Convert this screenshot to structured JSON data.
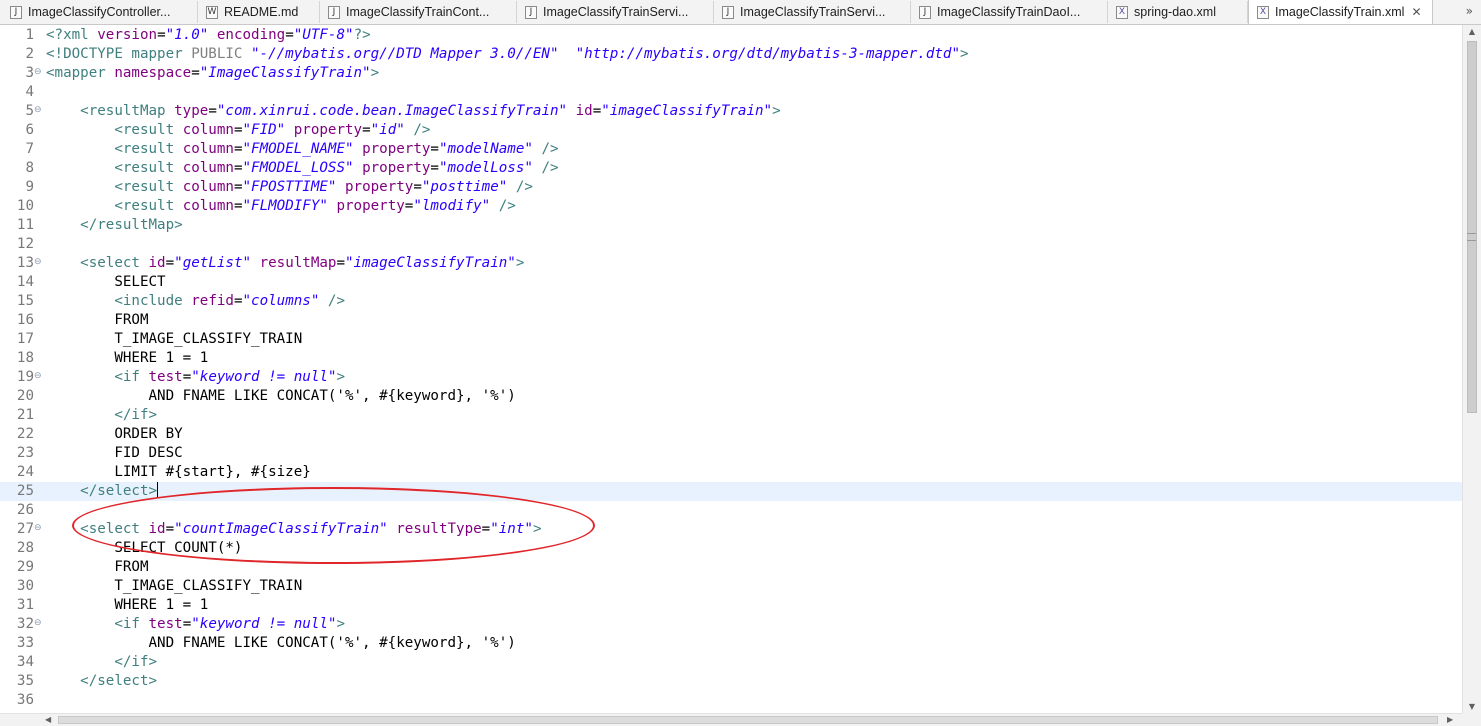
{
  "tabs": [
    {
      "label": "ImageClassifyController...",
      "icon": "java-file-icon",
      "glyph": "J",
      "active": false
    },
    {
      "label": "README.md",
      "icon": "markdown-file-icon",
      "glyph": "W",
      "active": false
    },
    {
      "label": "ImageClassifyTrainCont...",
      "icon": "java-file-icon",
      "glyph": "J",
      "active": false
    },
    {
      "label": "ImageClassifyTrainServi...",
      "icon": "java-file-icon",
      "glyph": "J",
      "active": false
    },
    {
      "label": "ImageClassifyTrainServi...",
      "icon": "java-file-icon",
      "glyph": "J",
      "active": false
    },
    {
      "label": "ImageClassifyTrainDaoI...",
      "icon": "java-file-icon",
      "glyph": "J",
      "active": false
    },
    {
      "label": "spring-dao.xml",
      "icon": "xml-file-icon",
      "glyph": "X",
      "active": false
    },
    {
      "label": "ImageClassifyTrain.xml",
      "icon": "xml-file-icon",
      "glyph": "X",
      "active": true,
      "close": "✕"
    }
  ],
  "tab_overflow": "»",
  "colors": {
    "tag": "#3f7f7f",
    "attribute": "#7f007f",
    "value": "#2a00ff",
    "annotation": "#e0262a",
    "current_line": "#e8f2fe"
  },
  "current_line": 25,
  "annotated_line": 27,
  "lines": [
    {
      "n": "1",
      "fold": "",
      "tokens": [
        [
          "t",
          "<?"
        ],
        [
          "t",
          "xml"
        ],
        [
          "p",
          " "
        ],
        [
          "a",
          "version"
        ],
        [
          "p",
          "="
        ],
        [
          "v",
          "\"1.0\""
        ],
        [
          "p",
          " "
        ],
        [
          "a",
          "encoding"
        ],
        [
          "p",
          "="
        ],
        [
          "v",
          "\"UTF-8\""
        ],
        [
          "t",
          "?>"
        ]
      ]
    },
    {
      "n": "2",
      "fold": "",
      "tokens": [
        [
          "t",
          "<!DOCTYPE mapper "
        ],
        [
          "d",
          "PUBLIC"
        ],
        [
          "p",
          " "
        ],
        [
          "v",
          "\"-//mybatis.org//DTD Mapper 3.0//EN\""
        ],
        [
          "p",
          "  "
        ],
        [
          "v",
          "\"http://mybatis.org/dtd/mybatis-3-mapper.dtd\""
        ],
        [
          "t",
          ">"
        ]
      ]
    },
    {
      "n": "3",
      "fold": "⊖",
      "tokens": [
        [
          "t",
          "<mapper"
        ],
        [
          "p",
          " "
        ],
        [
          "a",
          "namespace"
        ],
        [
          "p",
          "="
        ],
        [
          "v",
          "\"ImageClassifyTrain\""
        ],
        [
          "t",
          ">"
        ]
      ]
    },
    {
      "n": "4",
      "fold": "",
      "tokens": []
    },
    {
      "n": "5",
      "fold": "⊖",
      "tokens": [
        [
          "p",
          "    "
        ],
        [
          "t",
          "<resultMap"
        ],
        [
          "p",
          " "
        ],
        [
          "a",
          "type"
        ],
        [
          "p",
          "="
        ],
        [
          "v",
          "\"com.xinrui.code.bean.ImageClassifyTrain\""
        ],
        [
          "p",
          " "
        ],
        [
          "a",
          "id"
        ],
        [
          "p",
          "="
        ],
        [
          "v",
          "\"imageClassifyTrain\""
        ],
        [
          "t",
          ">"
        ]
      ]
    },
    {
      "n": "6",
      "fold": "",
      "tokens": [
        [
          "p",
          "        "
        ],
        [
          "t",
          "<result"
        ],
        [
          "p",
          " "
        ],
        [
          "a",
          "column"
        ],
        [
          "p",
          "="
        ],
        [
          "v",
          "\"FID\""
        ],
        [
          "p",
          " "
        ],
        [
          "a",
          "property"
        ],
        [
          "p",
          "="
        ],
        [
          "v",
          "\"id\""
        ],
        [
          "p",
          " "
        ],
        [
          "t",
          "/>"
        ]
      ]
    },
    {
      "n": "7",
      "fold": "",
      "tokens": [
        [
          "p",
          "        "
        ],
        [
          "t",
          "<result"
        ],
        [
          "p",
          " "
        ],
        [
          "a",
          "column"
        ],
        [
          "p",
          "="
        ],
        [
          "v",
          "\"FMODEL_NAME\""
        ],
        [
          "p",
          " "
        ],
        [
          "a",
          "property"
        ],
        [
          "p",
          "="
        ],
        [
          "v",
          "\"modelName\""
        ],
        [
          "p",
          " "
        ],
        [
          "t",
          "/>"
        ]
      ]
    },
    {
      "n": "8",
      "fold": "",
      "tokens": [
        [
          "p",
          "        "
        ],
        [
          "t",
          "<result"
        ],
        [
          "p",
          " "
        ],
        [
          "a",
          "column"
        ],
        [
          "p",
          "="
        ],
        [
          "v",
          "\"FMODEL_LOSS\""
        ],
        [
          "p",
          " "
        ],
        [
          "a",
          "property"
        ],
        [
          "p",
          "="
        ],
        [
          "v",
          "\"modelLoss\""
        ],
        [
          "p",
          " "
        ],
        [
          "t",
          "/>"
        ]
      ]
    },
    {
      "n": "9",
      "fold": "",
      "tokens": [
        [
          "p",
          "        "
        ],
        [
          "t",
          "<result"
        ],
        [
          "p",
          " "
        ],
        [
          "a",
          "column"
        ],
        [
          "p",
          "="
        ],
        [
          "v",
          "\"FPOSTTIME\""
        ],
        [
          "p",
          " "
        ],
        [
          "a",
          "property"
        ],
        [
          "p",
          "="
        ],
        [
          "v",
          "\"posttime\""
        ],
        [
          "p",
          " "
        ],
        [
          "t",
          "/>"
        ]
      ]
    },
    {
      "n": "10",
      "fold": "",
      "tokens": [
        [
          "p",
          "        "
        ],
        [
          "t",
          "<result"
        ],
        [
          "p",
          " "
        ],
        [
          "a",
          "column"
        ],
        [
          "p",
          "="
        ],
        [
          "v",
          "\"FLMODIFY\""
        ],
        [
          "p",
          " "
        ],
        [
          "a",
          "property"
        ],
        [
          "p",
          "="
        ],
        [
          "v",
          "\"lmodify\""
        ],
        [
          "p",
          " "
        ],
        [
          "t",
          "/>"
        ]
      ]
    },
    {
      "n": "11",
      "fold": "",
      "tokens": [
        [
          "p",
          "    "
        ],
        [
          "t",
          "</resultMap>"
        ]
      ]
    },
    {
      "n": "12",
      "fold": "",
      "tokens": []
    },
    {
      "n": "13",
      "fold": "⊖",
      "tokens": [
        [
          "p",
          "    "
        ],
        [
          "t",
          "<select"
        ],
        [
          "p",
          " "
        ],
        [
          "a",
          "id"
        ],
        [
          "p",
          "="
        ],
        [
          "v",
          "\"getList\""
        ],
        [
          "p",
          " "
        ],
        [
          "a",
          "resultMap"
        ],
        [
          "p",
          "="
        ],
        [
          "v",
          "\"imageClassifyTrain\""
        ],
        [
          "t",
          ">"
        ]
      ]
    },
    {
      "n": "14",
      "fold": "",
      "tokens": [
        [
          "p",
          "        SELECT"
        ]
      ]
    },
    {
      "n": "15",
      "fold": "",
      "tokens": [
        [
          "p",
          "        "
        ],
        [
          "t",
          "<include"
        ],
        [
          "p",
          " "
        ],
        [
          "a",
          "refid"
        ],
        [
          "p",
          "="
        ],
        [
          "v",
          "\"columns\""
        ],
        [
          "p",
          " "
        ],
        [
          "t",
          "/>"
        ]
      ]
    },
    {
      "n": "16",
      "fold": "",
      "tokens": [
        [
          "p",
          "        FROM"
        ]
      ]
    },
    {
      "n": "17",
      "fold": "",
      "tokens": [
        [
          "p",
          "        T_IMAGE_CLASSIFY_TRAIN"
        ]
      ]
    },
    {
      "n": "18",
      "fold": "",
      "tokens": [
        [
          "p",
          "        WHERE 1 = 1"
        ]
      ]
    },
    {
      "n": "19",
      "fold": "⊖",
      "tokens": [
        [
          "p",
          "        "
        ],
        [
          "t",
          "<if"
        ],
        [
          "p",
          " "
        ],
        [
          "a",
          "test"
        ],
        [
          "p",
          "="
        ],
        [
          "v",
          "\"keyword != null\""
        ],
        [
          "t",
          ">"
        ]
      ]
    },
    {
      "n": "20",
      "fold": "",
      "tokens": [
        [
          "p",
          "            AND FNAME LIKE CONCAT('%', #{keyword}, '%')"
        ]
      ]
    },
    {
      "n": "21",
      "fold": "",
      "tokens": [
        [
          "p",
          "        "
        ],
        [
          "t",
          "</if>"
        ]
      ]
    },
    {
      "n": "22",
      "fold": "",
      "tokens": [
        [
          "p",
          "        ORDER BY"
        ]
      ]
    },
    {
      "n": "23",
      "fold": "",
      "tokens": [
        [
          "p",
          "        FID DESC"
        ]
      ]
    },
    {
      "n": "24",
      "fold": "",
      "tokens": [
        [
          "p",
          "        LIMIT #{start}, #{size}"
        ]
      ]
    },
    {
      "n": "25",
      "fold": "",
      "tokens": [
        [
          "p",
          "    "
        ],
        [
          "t",
          "</select>"
        ]
      ],
      "caret": true
    },
    {
      "n": "26",
      "fold": "",
      "tokens": []
    },
    {
      "n": "27",
      "fold": "⊖",
      "tokens": [
        [
          "p",
          "    "
        ],
        [
          "t",
          "<select"
        ],
        [
          "p",
          " "
        ],
        [
          "a",
          "id"
        ],
        [
          "p",
          "="
        ],
        [
          "v",
          "\"countImageClassifyTrain\""
        ],
        [
          "p",
          " "
        ],
        [
          "a",
          "resultType"
        ],
        [
          "p",
          "="
        ],
        [
          "v",
          "\"int\""
        ],
        [
          "t",
          ">"
        ]
      ]
    },
    {
      "n": "28",
      "fold": "",
      "tokens": [
        [
          "p",
          "        SELECT COUNT(*)"
        ]
      ]
    },
    {
      "n": "29",
      "fold": "",
      "tokens": [
        [
          "p",
          "        FROM"
        ]
      ]
    },
    {
      "n": "30",
      "fold": "",
      "tokens": [
        [
          "p",
          "        T_IMAGE_CLASSIFY_TRAIN"
        ]
      ]
    },
    {
      "n": "31",
      "fold": "",
      "tokens": [
        [
          "p",
          "        WHERE 1 = 1"
        ]
      ]
    },
    {
      "n": "32",
      "fold": "⊖",
      "tokens": [
        [
          "p",
          "        "
        ],
        [
          "t",
          "<if"
        ],
        [
          "p",
          " "
        ],
        [
          "a",
          "test"
        ],
        [
          "p",
          "="
        ],
        [
          "v",
          "\"keyword != null\""
        ],
        [
          "t",
          ">"
        ]
      ]
    },
    {
      "n": "33",
      "fold": "",
      "tokens": [
        [
          "p",
          "            AND FNAME LIKE CONCAT('%', #{keyword}, '%')"
        ]
      ]
    },
    {
      "n": "34",
      "fold": "",
      "tokens": [
        [
          "p",
          "        "
        ],
        [
          "t",
          "</if>"
        ]
      ]
    },
    {
      "n": "35",
      "fold": "",
      "tokens": [
        [
          "p",
          "    "
        ],
        [
          "t",
          "</select>"
        ]
      ]
    },
    {
      "n": "36",
      "fold": "",
      "tokens": []
    }
  ],
  "scrollbars": {
    "up": "▲",
    "down": "▼",
    "left": "◀",
    "right": "▶"
  }
}
